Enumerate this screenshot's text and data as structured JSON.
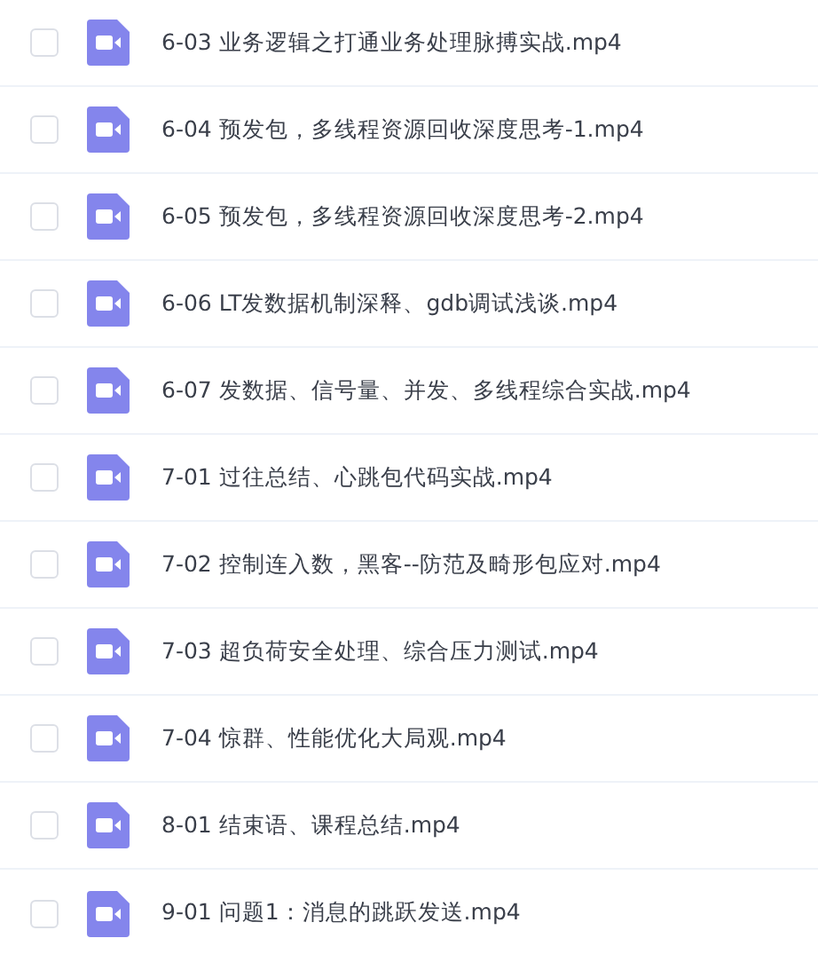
{
  "files": [
    {
      "name": "6-03 业务逻辑之打通业务处理脉搏实战.mp4",
      "checked": false
    },
    {
      "name": "6-04 预发包，多线程资源回收深度思考-1.mp4",
      "checked": false
    },
    {
      "name": "6-05 预发包，多线程资源回收深度思考-2.mp4",
      "checked": false
    },
    {
      "name": "6-06 LT发数据机制深释、gdb调试浅谈.mp4",
      "checked": false
    },
    {
      "name": "6-07 发数据、信号量、并发、多线程综合实战.mp4",
      "checked": false
    },
    {
      "name": "7-01 过往总结、心跳包代码实战.mp4",
      "checked": false
    },
    {
      "name": "7-02 控制连入数，黑客--防范及畸形包应对.mp4",
      "checked": false
    },
    {
      "name": "7-03 超负荷安全处理、综合压力测试.mp4",
      "checked": false
    },
    {
      "name": "7-04 惊群、性能优化大局观.mp4",
      "checked": false
    },
    {
      "name": "8-01 结束语、课程总结.mp4",
      "checked": false
    },
    {
      "name": "9-01 问题1：消息的跳跃发送.mp4",
      "checked": false
    }
  ]
}
